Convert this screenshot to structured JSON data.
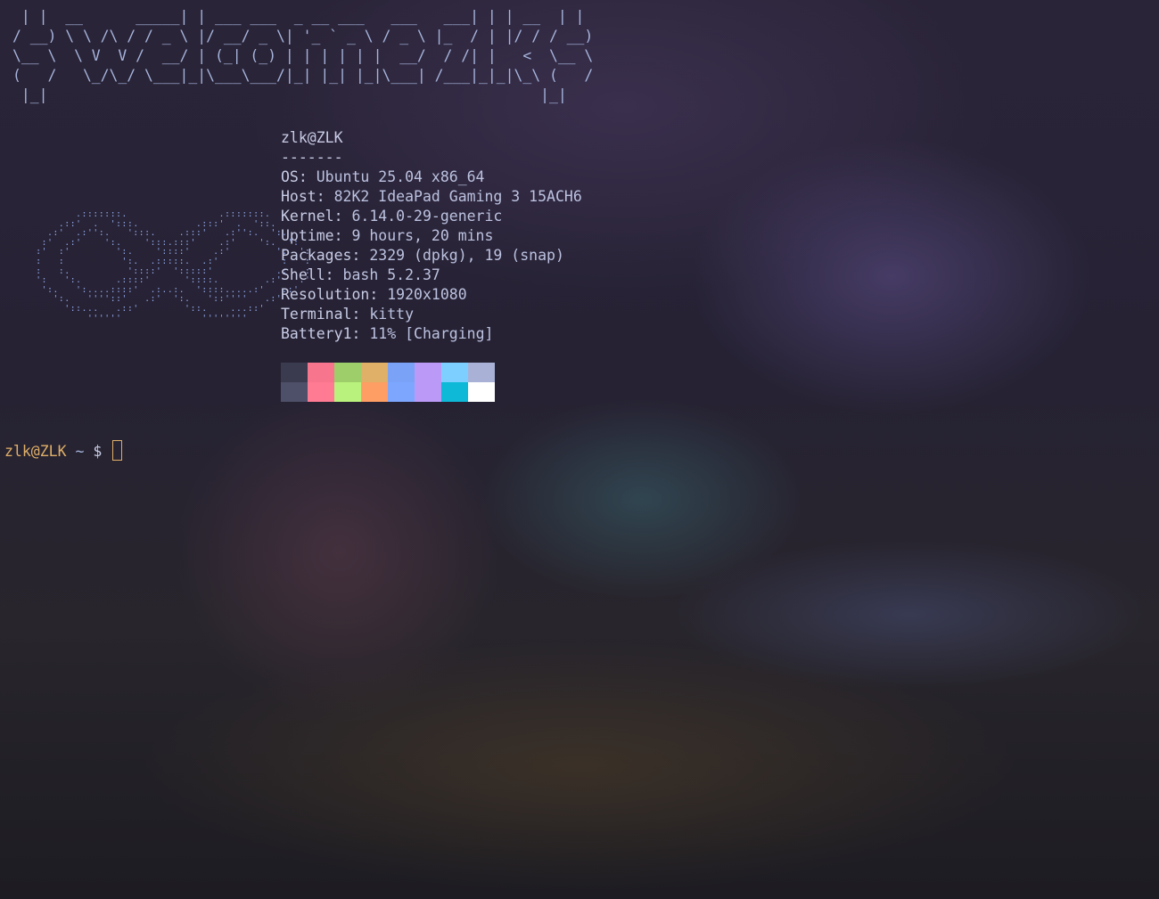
{
  "banner_lines": [
    " | |  __      _____| | ___ ___  _ __ ___   ___   ___| | | __  | |",
    "/ __) \\ \\ /\\ / / _ \\ |/ __/ _ \\| '_ ` _ \\ / _ \\ |_  / | |/ / / __)",
    "\\__ \\  \\ V  V /  __/ | (_| (_) | | | | | |  __/  / /| |   <  \\__ \\",
    "(   /   \\_/\\_/ \\___|_|\\___\\___/|_| |_| |_|\\___| /___|_|_|\\_\\ (   /",
    " |_|                                                        |_|"
  ],
  "logo_lines": [
    "            .:::::::.                .:::::::.",
    "         .::'  .  ':::.          .:::'  .  '::.",
    "       .:'  .:'':.   ':::.    .:::'   .:'':.  ':.",
    "      :'  .:'    ':.    ':::.:::'    .:'    ':.  ':",
    "     :'  :'        ':.    '::::'    .:'        ':  ':",
    "     :   :          ':.  .:::::.  .:'           :   :",
    "     :   :.          '::::'  ':::::'           .:   :",
    "     ':   ':.      .::::'      '::::.        .:'   :'",
    "      ':.   ':....::::'  .:..:.  '::::.....:'   .:'",
    "        ':.   ''''::'   .:'  ':.   '::''''   .:'",
    "          '::...   .::'        '::.    ...::'",
    "              ''''''              ''''''''"
  ],
  "sysinfo": {
    "title": "zlk@ZLK",
    "separator": "-------",
    "fields": [
      {
        "key": "OS",
        "value": "Ubuntu 25.04 x86_64"
      },
      {
        "key": "Host",
        "value": "82K2 IdeaPad Gaming 3 15ACH6"
      },
      {
        "key": "Kernel",
        "value": "6.14.0-29-generic"
      },
      {
        "key": "Uptime",
        "value": "9 hours, 20 mins"
      },
      {
        "key": "Packages",
        "value": "2329 (dpkg), 19 (snap)"
      },
      {
        "key": "Shell",
        "value": "bash 5.2.37"
      },
      {
        "key": "Resolution",
        "value": "1920x1080"
      },
      {
        "key": "Terminal",
        "value": "kitty"
      },
      {
        "key": "Battery1",
        "value": "11% [Charging]"
      }
    ]
  },
  "palette": {
    "normal": [
      "#3b3b4f",
      "#f7768e",
      "#9ece6a",
      "#e0af68",
      "#7aa2f7",
      "#bb9af7",
      "#7dcfff",
      "#a9b1d6"
    ],
    "bright": [
      "#4e4f68",
      "#ff7a93",
      "#b9f27c",
      "#ff9e64",
      "#7da6ff",
      "#bb9af7",
      "#0db9d7",
      "#ffffff"
    ]
  },
  "prompt": {
    "user_host": "zlk@ZLK",
    "dir": " ~",
    "symbol": " $"
  }
}
